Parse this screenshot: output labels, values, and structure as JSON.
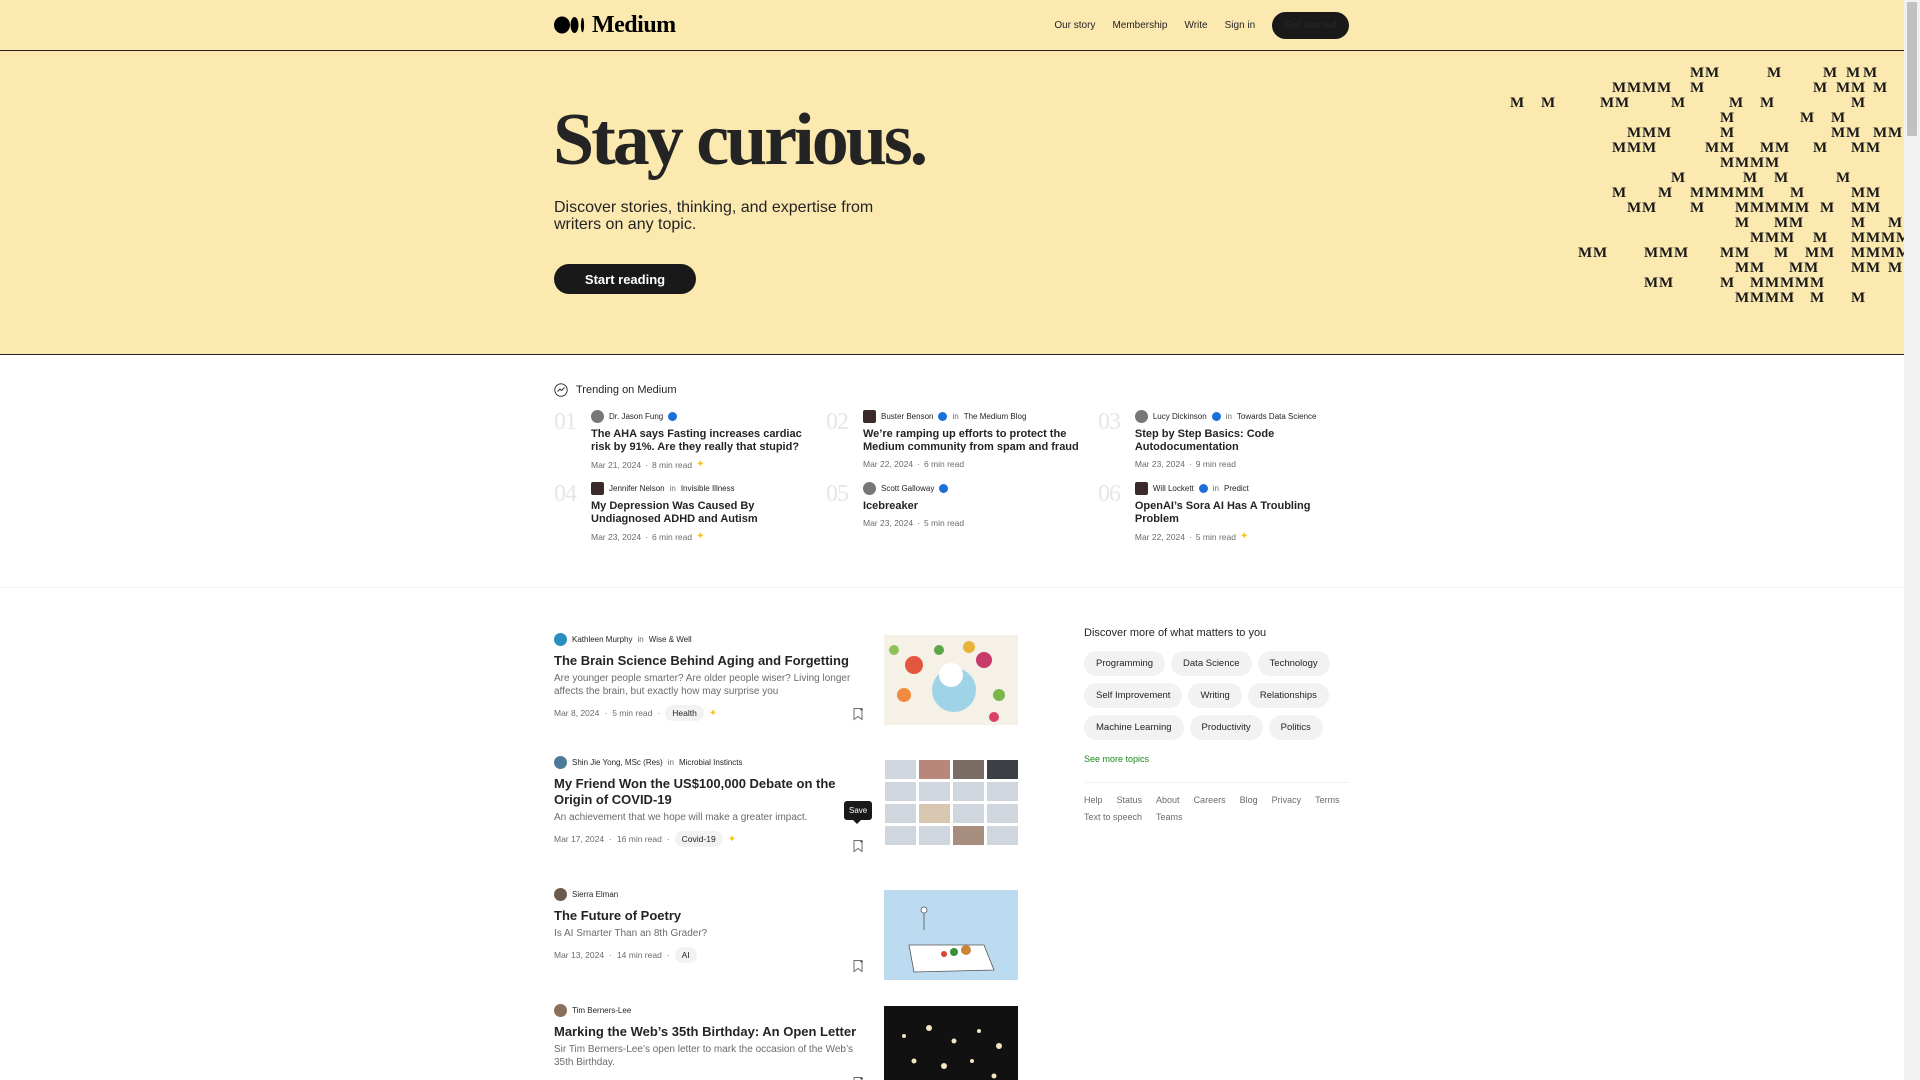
{
  "header": {
    "logo_text": "Medium",
    "nav": [
      "Our story",
      "Membership",
      "Write",
      "Sign in"
    ],
    "cta": "Get started"
  },
  "hero": {
    "title": "Stay curious.",
    "subtitle": "Discover stories, thinking, and expertise from writers on any topic.",
    "button": "Start reading",
    "pattern_letter": "M"
  },
  "trending": {
    "heading": "Trending on Medium",
    "items": [
      {
        "num": "01",
        "author": "Dr. Jason Fung",
        "publication": "",
        "title": "The AHA says Fasting increases cardiac risk by 91%. Are they really that stupid?",
        "date": "Mar 21, 2024",
        "read": "8 min read",
        "star": true
      },
      {
        "num": "02",
        "author": "Buster Benson",
        "publication": "The Medium Blog",
        "title": "We’re ramping up efforts to protect the Medium community from spam and fraud",
        "date": "Mar 22, 2024",
        "read": "6 min read",
        "star": false
      },
      {
        "num": "03",
        "author": "Lucy Dickinson",
        "publication": "Towards Data Science",
        "title": "Step by Step Basics: Code Autodocumentation",
        "date": "Mar 23, 2024",
        "read": "9 min read",
        "star": false
      },
      {
        "num": "04",
        "author": "Jennifer Nelson",
        "publication": "Invisible Illness",
        "title": "My Depression Was Caused By Undiagnosed ADHD and Autism",
        "date": "Mar 23, 2024",
        "read": "6 min read",
        "star": true
      },
      {
        "num": "05",
        "author": "Scott Galloway",
        "publication": "",
        "title": "Icebreaker",
        "date": "Mar 23, 2024",
        "read": "5 min read",
        "star": false
      },
      {
        "num": "06",
        "author": "Will Lockett",
        "publication": "Predict",
        "title": "OpenAI’s Sora AI Has A Troubling Problem",
        "date": "Mar 22, 2024",
        "read": "5 min read",
        "star": true
      }
    ]
  },
  "in_word": "in",
  "feed": [
    {
      "author": "Kathleen Murphy",
      "publication": "Wise & Well",
      "title": "The Brain Science Behind Aging and Forgetting",
      "subtitle": "Are younger people smarter? Are older people wiser? Living longer affects the brain, but exactly how may surprise you",
      "date": "Mar 8, 2024",
      "read": "5 min read",
      "tag": "Health",
      "star": true
    },
    {
      "author": "Shin Jie Yong, MSc (Res)",
      "publication": "Microbial Instincts",
      "title": "My Friend Won the US$100,000 Debate on the Origin of COVID-19",
      "subtitle": "An achievement that we hope will make a greater impact.",
      "date": "Mar 17, 2024",
      "read": "16 min read",
      "tag": "Covid-19",
      "star": true
    },
    {
      "author": "Sierra Elman",
      "publication": "",
      "title": "The Future of Poetry",
      "subtitle": "Is AI Smarter Than an 8th Grader?",
      "date": "Mar 13, 2024",
      "read": "14 min read",
      "tag": "AI",
      "star": false
    },
    {
      "author": "Tim Berners-Lee",
      "publication": "",
      "title": "Marking the Web’s 35th Birthday: An Open Letter",
      "subtitle": "Sir Tim Berners-Lee’s open letter to mark the occasion of the Web’s 35th Birthday.",
      "date": "",
      "read": "",
      "tag": "",
      "star": false
    }
  ],
  "tooltip": "Save",
  "sidebar": {
    "title": "Discover more of what matters to you",
    "topics": [
      "Programming",
      "Data Science",
      "Technology",
      "Self Improvement",
      "Writing",
      "Relationships",
      "Machine Learning",
      "Productivity",
      "Politics"
    ],
    "see_more": "See more topics",
    "footer": [
      "Help",
      "Status",
      "About",
      "Careers",
      "Blog",
      "Privacy",
      "Terms",
      "Text to speech",
      "Teams"
    ]
  },
  "colors": {
    "hero_bg": "#fbe9b0",
    "accent_green": "#1a8917",
    "star": "#ffc017",
    "dark": "#191919"
  }
}
